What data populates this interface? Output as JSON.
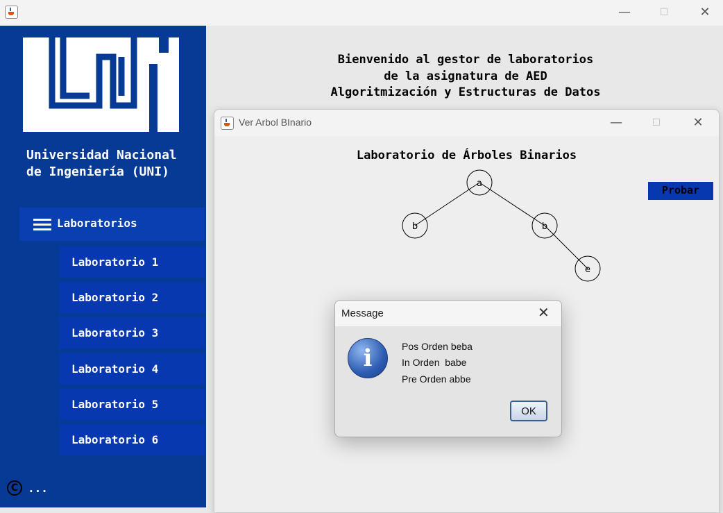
{
  "window": {
    "minimize_glyph": "—",
    "maximize_glyph": "☐",
    "close_glyph": "✕"
  },
  "sidebar": {
    "university_name": "Universidad Nacional\nde Ingeniería (UNI)",
    "menu_label": "Laboratorios",
    "items": [
      {
        "label": "Laboratorio 1"
      },
      {
        "label": "Laboratorio 2"
      },
      {
        "label": "Laboratorio 3"
      },
      {
        "label": "Laboratorio 4"
      },
      {
        "label": "Laboratorio 5"
      },
      {
        "label": "Laboratorio 6"
      }
    ],
    "footer_symbol": "C",
    "footer_text": "..."
  },
  "welcome": {
    "line1": "Bienvenido al gestor de laboratorios",
    "line2": "de la asignatura de AED",
    "line3": "Algoritmización y Estructuras de Datos"
  },
  "tree_window": {
    "title": "Ver Arbol BInario",
    "heading": "Laboratorio de Árboles Binarios",
    "probar_label": "Probar",
    "nodes": [
      "a",
      "b",
      "b",
      "e"
    ]
  },
  "dialog": {
    "title": "Message",
    "close_glyph": "✕",
    "icon_glyph": "i",
    "lines": [
      "Pos Orden beba",
      "In Orden  babe",
      "Pre Orden abbe"
    ],
    "ok_label": "OK"
  },
  "colors": {
    "sidebar_bg": "#063a95",
    "menu_item_bg": "#0838b0",
    "accent_button": "#0838b0"
  }
}
